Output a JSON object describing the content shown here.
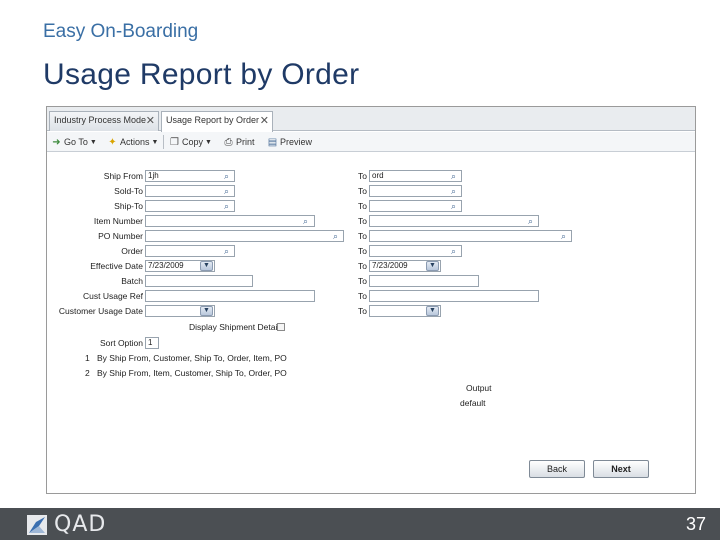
{
  "slide": {
    "kicker": "Easy On-Boarding",
    "title": "Usage Report by Order",
    "page_number": "37",
    "logo_text": "QAD"
  },
  "tabs": [
    {
      "label": "Industry Process Mode",
      "active": false
    },
    {
      "label": "Usage Report by Order",
      "active": true
    }
  ],
  "toolbar": {
    "goto": "Go To",
    "actions": "Actions",
    "copy": "Copy",
    "print": "Print",
    "preview": "Preview"
  },
  "form": {
    "ship_from": {
      "label": "Ship From",
      "from": "1jh",
      "to": "ord"
    },
    "sold_to": {
      "label": "Sold-To",
      "from": "",
      "to": ""
    },
    "ship_to": {
      "label": "Ship-To",
      "from": "",
      "to": ""
    },
    "item_number": {
      "label": "Item Number",
      "from": "",
      "to": ""
    },
    "po_number": {
      "label": "PO Number",
      "from": "",
      "to": ""
    },
    "order": {
      "label": "Order",
      "from": "",
      "to": ""
    },
    "effective_date": {
      "label": "Effective Date",
      "from": "7/23/2009",
      "to": "7/23/2009"
    },
    "batch": {
      "label": "Batch",
      "from": "",
      "to": ""
    },
    "cust_usage_ref": {
      "label": "Cust Usage Ref",
      "from": "",
      "to": ""
    },
    "customer_usage_date": {
      "label": "Customer Usage Date",
      "from": "",
      "to": ""
    },
    "to_label": "To",
    "display_shipment_detail": "Display Shipment Detail:",
    "sort_option_label": "Sort Option",
    "sort_option_value": "1",
    "sort_options": [
      {
        "num": "1",
        "text": "By Ship From, Customer, Ship To, Order, Item, PO"
      },
      {
        "num": "2",
        "text": "By Ship From, Item, Customer, Ship To, Order, PO"
      }
    ],
    "output_label": "Output",
    "output_value": "default"
  },
  "buttons": {
    "back": "Back",
    "next": "Next"
  },
  "colors": {
    "kicker": "#3a6fa5",
    "title": "#1f3a66",
    "footer": "#4b4f53"
  }
}
